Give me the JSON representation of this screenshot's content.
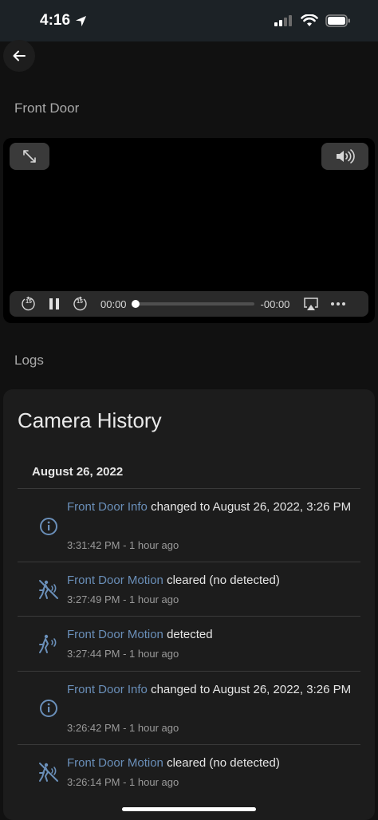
{
  "status_bar": {
    "time": "4:16"
  },
  "page": {
    "camera_title": "Front Door",
    "logs_title": "Logs"
  },
  "player": {
    "elapsed": "00:00",
    "remaining": "-00:00",
    "skip_back_seconds": "15",
    "skip_forward_seconds": "15",
    "progress": 0
  },
  "history": {
    "title": "Camera History",
    "date": "August 26, 2022",
    "entries": [
      {
        "entity": "Front Door Info",
        "action": "changed to August 26, 2022, 3:26 PM",
        "time": "3:31:42 PM - 1 hour ago",
        "icon": "info-icon"
      },
      {
        "entity": "Front Door Motion",
        "action": "cleared (no detected)",
        "time": "3:27:49 PM - 1 hour ago",
        "icon": "motion-cleared-icon"
      },
      {
        "entity": "Front Door Motion",
        "action": "detected",
        "time": "3:27:44 PM - 1 hour ago",
        "icon": "motion-detected-icon"
      },
      {
        "entity": "Front Door Info",
        "action": "changed to August 26, 2022, 3:26 PM",
        "time": "3:26:42 PM - 1 hour ago",
        "icon": "info-icon"
      },
      {
        "entity": "Front Door Motion",
        "action": "cleared (no detected)",
        "time": "3:26:14 PM - 1 hour ago",
        "icon": "motion-cleared-icon"
      }
    ]
  },
  "colors": {
    "entity_link": "#6a8fb9",
    "background": "#111111",
    "card": "#1c1c1c"
  }
}
